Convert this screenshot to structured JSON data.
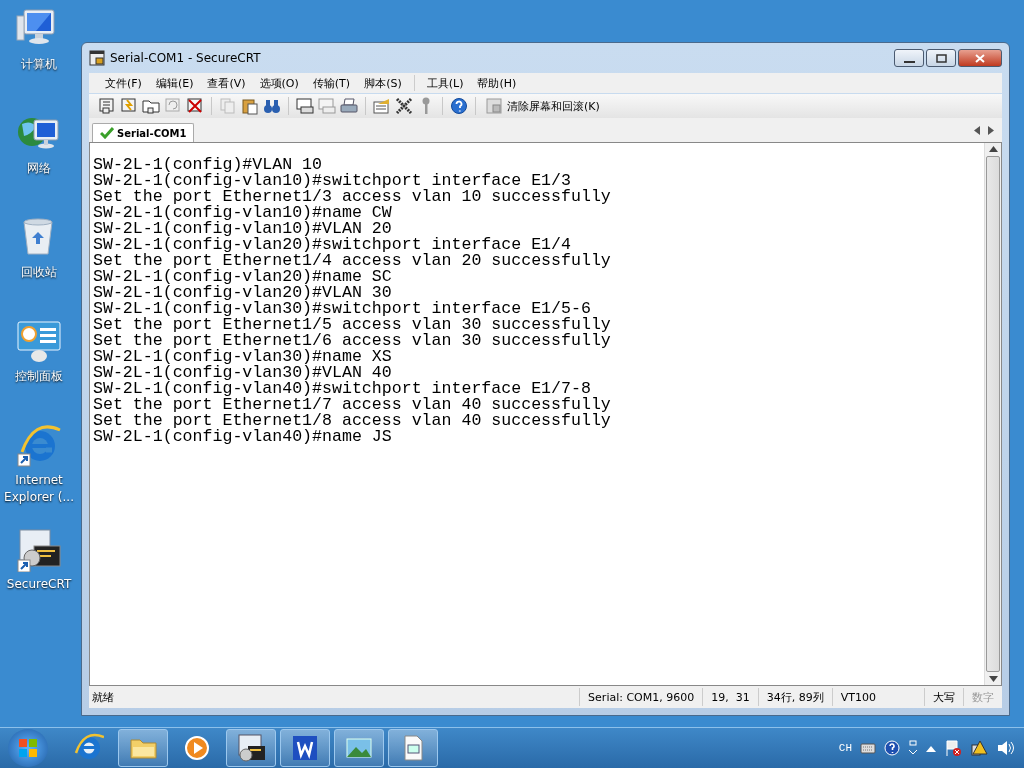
{
  "desktop_icons": [
    {
      "label": "计算机",
      "kind": "computer"
    },
    {
      "label": "网络",
      "kind": "network"
    },
    {
      "label": "回收站",
      "kind": "recycle"
    },
    {
      "label": "控制面板",
      "kind": "panel"
    },
    {
      "label": "Internet Explorer (...",
      "kind": "ie"
    },
    {
      "label": "SecureCRT",
      "kind": "crt"
    }
  ],
  "window": {
    "title": "Serial-COM1 - SecureCRT"
  },
  "menu": [
    "文件(F)",
    "编辑(E)",
    "查看(V)",
    "选项(O)",
    "传输(T)",
    "脚本(S)",
    "工具(L)",
    "帮助(H)"
  ],
  "toolbar": {
    "clear_button": "清除屏幕和回滚(K)"
  },
  "tabs": [
    {
      "label": "Serial-COM1",
      "selected": true,
      "connected": true
    }
  ],
  "terminal": {
    "lines": [
      "SW-2L-1(config)#VLAN 10",
      "SW-2L-1(config-vlan10)#switchport interface E1/3",
      "Set the port Ethernet1/3 access vlan 10 successfully",
      "SW-2L-1(config-vlan10)#name CW",
      "SW-2L-1(config-vlan10)#VLAN 20",
      "SW-2L-1(config-vlan20)#switchport interface E1/4",
      "Set the port Ethernet1/4 access vlan 20 successfully",
      "SW-2L-1(config-vlan20)#name SC",
      "SW-2L-1(config-vlan20)#VLAN 30",
      "SW-2L-1(config-vlan30)#switchport interface E1/5-6",
      "Set the port Ethernet1/5 access vlan 30 successfully",
      "Set the port Ethernet1/6 access vlan 30 successfully",
      "SW-2L-1(config-vlan30)#name XS",
      "SW-2L-1(config-vlan30)#VLAN 40",
      "SW-2L-1(config-vlan40)#switchport interface E1/7-8",
      "Set the port Ethernet1/7 access vlan 40 successfully",
      "Set the port Ethernet1/8 access vlan 40 successfully",
      "SW-2L-1(config-vlan40)#name JS"
    ]
  },
  "status_bar": {
    "message": "就绪",
    "fields": [
      {
        "text": "Serial: COM1, 9600",
        "disabled": false
      },
      {
        "text": "19,  31",
        "disabled": false
      },
      {
        "text": "34行, 89列",
        "disabled": false
      },
      {
        "text": "VT100",
        "disabled": false
      },
      {
        "text": "大写",
        "disabled": false
      },
      {
        "text": "数字",
        "disabled": true
      }
    ]
  },
  "taskbar": {
    "apps": [
      {
        "kind": "ie",
        "active": false
      },
      {
        "kind": "folder",
        "active": true
      },
      {
        "kind": "media",
        "active": false
      },
      {
        "kind": "crt",
        "active": true
      },
      {
        "kind": "wps",
        "active": true
      },
      {
        "kind": "photo",
        "active": true
      },
      {
        "kind": "doc",
        "active": true
      }
    ],
    "language": "CH"
  }
}
